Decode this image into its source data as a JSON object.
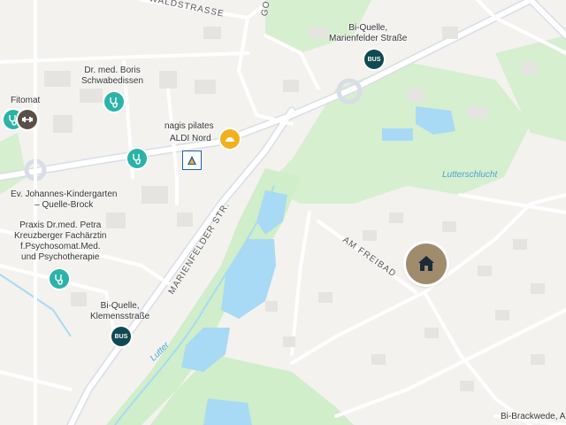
{
  "streets": {
    "waldstrasse": "WALDSTRASSE",
    "marienfelder": "MARIENFELDER STR.",
    "am_freibad": "AM FREIBAD",
    "g_fragment": "GO"
  },
  "water": {
    "lutter": "Lutter",
    "lutterschlucht": "Lutterschlucht"
  },
  "pois": {
    "bi_quelle_marienfelder": "Bi-Quelle,\nMarienfelder Straße",
    "bi_quelle_klemens": "Bi-Quelle,\nKlemensstraße",
    "bus_label": "BUS",
    "dr_boris": "Dr. med. Boris\nSchwabedissen",
    "fitomat": "Fitomat",
    "nagis": "nagis pilates",
    "aldi": "ALDI Nord",
    "kindergarten": "Ev. Johannes-Kindergarten\n– Quelle-Brock",
    "praxis": "Praxis Dr.med. Petra\nKreuzberger Fachärztin\nf.Psychosomat.Med.\nund Psychotherapie",
    "bi_brackwede": "Bi-Brackwede, A"
  },
  "icons": {
    "home": "home-icon",
    "medical": "stethoscope-icon",
    "fitness": "dumbbell-icon",
    "store": "shopping-cart-icon",
    "pilates": "pilates-icon"
  },
  "colors": {
    "background": "#f3f2ef",
    "park": "#cfeec9",
    "water": "#a9daf5",
    "road": "#ffffff",
    "main_road": "#d9dde6",
    "medical": "#2bb3a7",
    "bus": "#0f4a52",
    "home_pin": "#a08b6d",
    "pilates": "#f2b01e"
  }
}
